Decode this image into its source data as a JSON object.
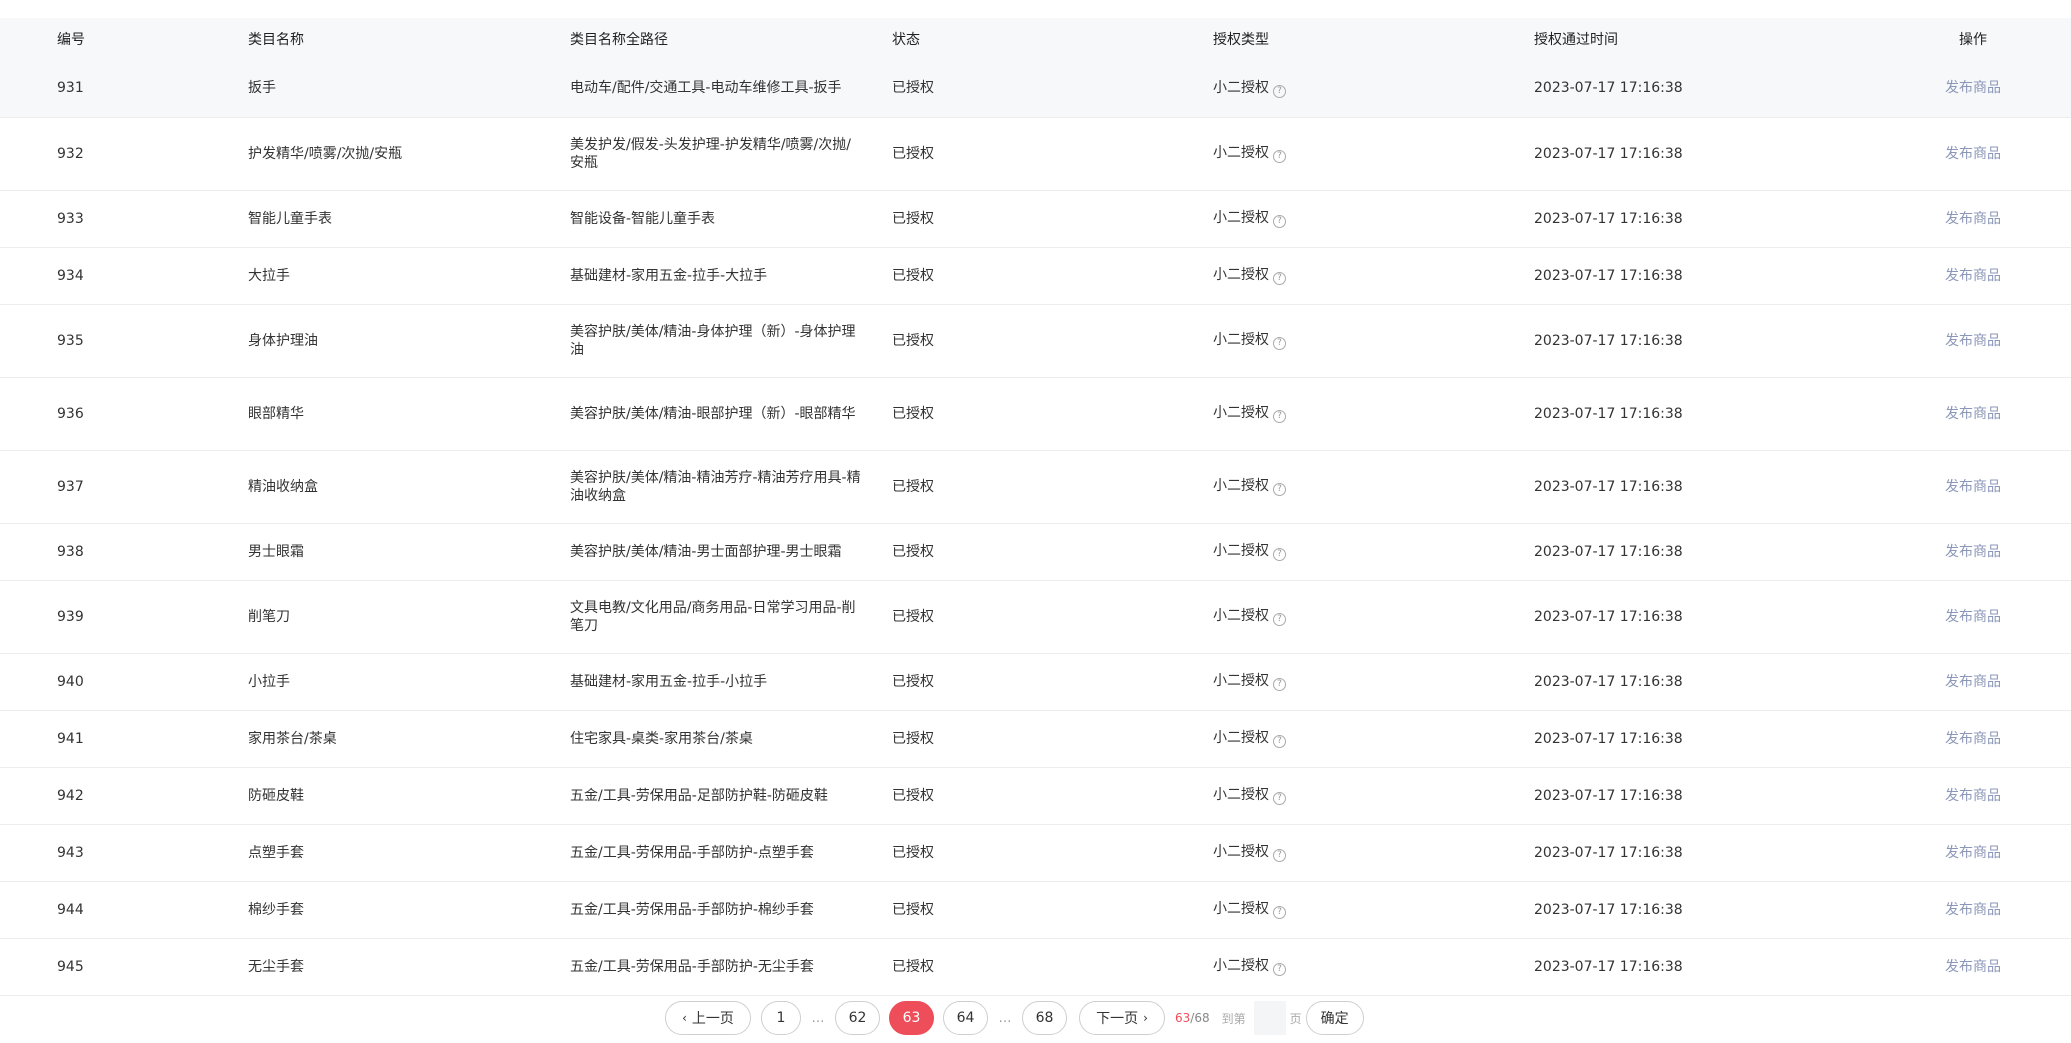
{
  "table": {
    "headers": {
      "id": "编号",
      "name": "类目名称",
      "path": "类目名称全路径",
      "status": "状态",
      "auth_type": "授权类型",
      "auth_time": "授权通过时间",
      "action": "操作"
    },
    "rows": [
      {
        "id": "931",
        "name": "扳手",
        "path": "电动车/配件/交通工具-电动车维修工具-扳手",
        "status": "已授权",
        "auth_type": "小二授权",
        "auth_time": "2023-07-17 17:16:38",
        "action": "发布商品"
      },
      {
        "id": "932",
        "name": "护发精华/喷雾/次抛/安瓶",
        "path": "美发护发/假发-头发护理-护发精华/喷雾/次抛/安瓶",
        "status": "已授权",
        "auth_type": "小二授权",
        "auth_time": "2023-07-17 17:16:38",
        "action": "发布商品"
      },
      {
        "id": "933",
        "name": "智能儿童手表",
        "path": "智能设备-智能儿童手表",
        "status": "已授权",
        "auth_type": "小二授权",
        "auth_time": "2023-07-17 17:16:38",
        "action": "发布商品"
      },
      {
        "id": "934",
        "name": "大拉手",
        "path": "基础建材-家用五金-拉手-大拉手",
        "status": "已授权",
        "auth_type": "小二授权",
        "auth_time": "2023-07-17 17:16:38",
        "action": "发布商品"
      },
      {
        "id": "935",
        "name": "身体护理油",
        "path": "美容护肤/美体/精油-身体护理（新）-身体护理油",
        "status": "已授权",
        "auth_type": "小二授权",
        "auth_time": "2023-07-17 17:16:38",
        "action": "发布商品"
      },
      {
        "id": "936",
        "name": "眼部精华",
        "path": "美容护肤/美体/精油-眼部护理（新）-眼部精华",
        "status": "已授权",
        "auth_type": "小二授权",
        "auth_time": "2023-07-17 17:16:38",
        "action": "发布商品"
      },
      {
        "id": "937",
        "name": "精油收纳盒",
        "path": "美容护肤/美体/精油-精油芳疗-精油芳疗用具-精油收纳盒",
        "status": "已授权",
        "auth_type": "小二授权",
        "auth_time": "2023-07-17 17:16:38",
        "action": "发布商品"
      },
      {
        "id": "938",
        "name": "男士眼霜",
        "path": "美容护肤/美体/精油-男士面部护理-男士眼霜",
        "status": "已授权",
        "auth_type": "小二授权",
        "auth_time": "2023-07-17 17:16:38",
        "action": "发布商品"
      },
      {
        "id": "939",
        "name": "削笔刀",
        "path": "文具电教/文化用品/商务用品-日常学习用品-削笔刀",
        "status": "已授权",
        "auth_type": "小二授权",
        "auth_time": "2023-07-17 17:16:38",
        "action": "发布商品"
      },
      {
        "id": "940",
        "name": "小拉手",
        "path": "基础建材-家用五金-拉手-小拉手",
        "status": "已授权",
        "auth_type": "小二授权",
        "auth_time": "2023-07-17 17:16:38",
        "action": "发布商品"
      },
      {
        "id": "941",
        "name": "家用茶台/茶桌",
        "path": "住宅家具-桌类-家用茶台/茶桌",
        "status": "已授权",
        "auth_type": "小二授权",
        "auth_time": "2023-07-17 17:16:38",
        "action": "发布商品"
      },
      {
        "id": "942",
        "name": "防砸皮鞋",
        "path": "五金/工具-劳保用品-足部防护鞋-防砸皮鞋",
        "status": "已授权",
        "auth_type": "小二授权",
        "auth_time": "2023-07-17 17:16:38",
        "action": "发布商品"
      },
      {
        "id": "943",
        "name": "点塑手套",
        "path": "五金/工具-劳保用品-手部防护-点塑手套",
        "status": "已授权",
        "auth_type": "小二授权",
        "auth_time": "2023-07-17 17:16:38",
        "action": "发布商品"
      },
      {
        "id": "944",
        "name": "棉纱手套",
        "path": "五金/工具-劳保用品-手部防护-棉纱手套",
        "status": "已授权",
        "auth_type": "小二授权",
        "auth_time": "2023-07-17 17:16:38",
        "action": "发布商品"
      },
      {
        "id": "945",
        "name": "无尘手套",
        "path": "五金/工具-劳保用品-手部防护-无尘手套",
        "status": "已授权",
        "auth_type": "小二授权",
        "auth_time": "2023-07-17 17:16:38",
        "action": "发布商品"
      }
    ]
  },
  "pagination": {
    "prev_label": "上一页",
    "next_label": "下一页",
    "prev_icon": "chevron-left-icon",
    "next_icon": "chevron-right-icon",
    "pages": [
      "1",
      "…",
      "62",
      "63",
      "64",
      "…",
      "68"
    ],
    "current": "63",
    "total": "68",
    "goto_label": "到第",
    "page_unit": "页",
    "goto_value": "",
    "confirm_label": "确定"
  },
  "colors": {
    "accent": "#ee4d5a",
    "link": "#8b97b8",
    "header_bg": "#f7f8fa"
  }
}
